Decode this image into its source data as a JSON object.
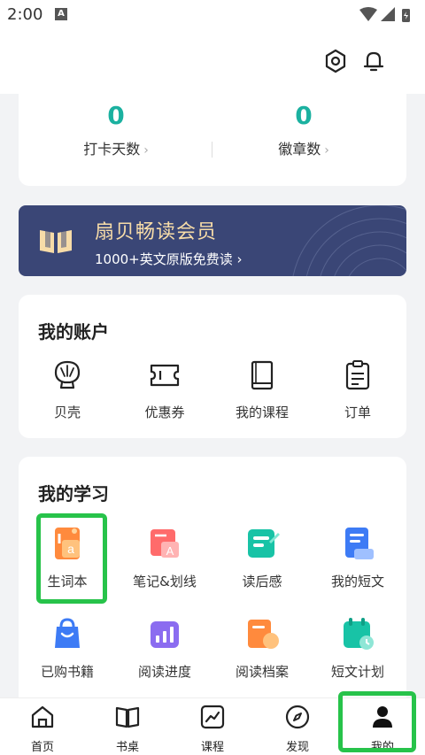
{
  "status": {
    "time": "2:00",
    "notif_letter": "A"
  },
  "stats": [
    {
      "value": "0",
      "label": "打卡天数"
    },
    {
      "value": "0",
      "label": "徽章数"
    }
  ],
  "vip": {
    "title": "扇贝畅读会员",
    "subtitle": "1000+英文原版免费读 ›"
  },
  "account": {
    "title": "我的账户",
    "items": [
      {
        "label": "贝壳",
        "icon": "shell-icon"
      },
      {
        "label": "优惠券",
        "icon": "coupon-icon"
      },
      {
        "label": "我的课程",
        "icon": "course-book-icon"
      },
      {
        "label": "订单",
        "icon": "order-clipboard-icon"
      }
    ]
  },
  "study": {
    "title": "我的学习",
    "items": [
      {
        "label": "生词本",
        "icon": "vocab-book-icon"
      },
      {
        "label": "笔记&划线",
        "icon": "notes-icon"
      },
      {
        "label": "读后感",
        "icon": "reflection-icon"
      },
      {
        "label": "我的短文",
        "icon": "my-article-icon"
      },
      {
        "label": "已购书籍",
        "icon": "purchased-books-icon"
      },
      {
        "label": "阅读进度",
        "icon": "reading-progress-icon"
      },
      {
        "label": "阅读档案",
        "icon": "reading-archive-icon"
      },
      {
        "label": "短文计划",
        "icon": "article-plan-icon"
      }
    ]
  },
  "nav": [
    {
      "label": "首页",
      "icon": "home-icon"
    },
    {
      "label": "书桌",
      "icon": "desk-book-icon"
    },
    {
      "label": "课程",
      "icon": "course-chart-icon"
    },
    {
      "label": "发现",
      "icon": "compass-icon"
    },
    {
      "label": "我的",
      "icon": "profile-icon"
    }
  ],
  "colors": {
    "accent": "#1bb1a0",
    "vip_bg": "#3a4676",
    "vip_gold": "#f7dca8",
    "highlight": "#27c34a"
  }
}
